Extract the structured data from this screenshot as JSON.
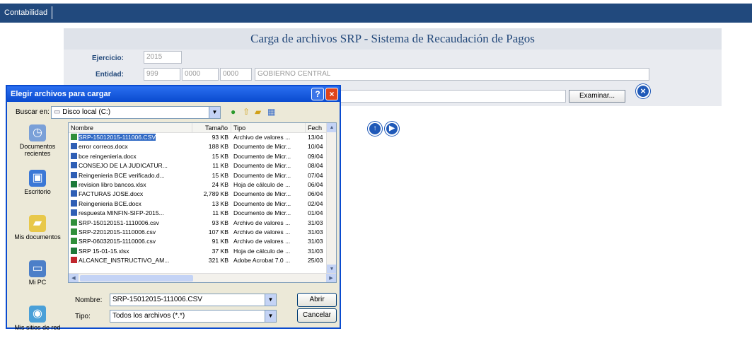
{
  "app": {
    "tab_label": "Contabilidad"
  },
  "form": {
    "title": "Carga de archivos SRP - Sistema de Recaudación de Pagos",
    "ejercicio_label": "Ejercicio:",
    "ejercicio_value": "2015",
    "entidad_label": "Entidad:",
    "entidad_values": [
      "999",
      "0000",
      "0000"
    ],
    "entidad_name": "GOBIERNO CENTRAL",
    "browse_label": "Examinar..."
  },
  "dialog": {
    "title": "Elegir archivos para cargar",
    "lookin_label": "Buscar en:",
    "lookin_value": "Disco local (C:)",
    "places": [
      {
        "label": "Documentos recientes",
        "icon": "recent-documents-icon"
      },
      {
        "label": "Escritorio",
        "icon": "desktop-icon"
      },
      {
        "label": "Mis documentos",
        "icon": "my-documents-icon"
      },
      {
        "label": "Mi PC",
        "icon": "my-computer-icon"
      },
      {
        "label": "Mis sitios de red",
        "icon": "network-places-icon"
      }
    ],
    "columns": [
      "Nombre",
      "Tamaño",
      "Tipo",
      "Fech"
    ],
    "files": [
      {
        "name": "SRP-15012015-111006.CSV",
        "size": "93 KB",
        "type": "Archivo de valores ...",
        "date": "13/04",
        "kind": "csv"
      },
      {
        "name": "error correos.docx",
        "size": "188 KB",
        "type": "Documento de Micr...",
        "date": "10/04",
        "kind": "doc"
      },
      {
        "name": "bce reingenieria.docx",
        "size": "15 KB",
        "type": "Documento de Micr...",
        "date": "09/04",
        "kind": "doc"
      },
      {
        "name": "CONSEJO DE LA JUDICATUR...",
        "size": "11 KB",
        "type": "Documento de Micr...",
        "date": "08/04",
        "kind": "doc"
      },
      {
        "name": "Reingenieria BCE verificado.d...",
        "size": "15 KB",
        "type": "Documento de Micr...",
        "date": "07/04",
        "kind": "doc"
      },
      {
        "name": "revision libro bancos.xlsx",
        "size": "24 KB",
        "type": "Hoja de cálculo de ...",
        "date": "06/04",
        "kind": "xls"
      },
      {
        "name": "FACTURAS JOSE.docx",
        "size": "2,789 KB",
        "type": "Documento de Micr...",
        "date": "06/04",
        "kind": "doc"
      },
      {
        "name": "Reingenieria BCE.docx",
        "size": "13 KB",
        "type": "Documento de Micr...",
        "date": "02/04",
        "kind": "doc"
      },
      {
        "name": "respuesta MINFIN-SIFP-2015...",
        "size": "11 KB",
        "type": "Documento de Micr...",
        "date": "01/04",
        "kind": "doc"
      },
      {
        "name": "SRP-150120151-1110006.csv",
        "size": "93 KB",
        "type": "Archivo de valores ...",
        "date": "31/03",
        "kind": "csv"
      },
      {
        "name": "SRP-22012015-1110006.csv",
        "size": "107 KB",
        "type": "Archivo de valores ...",
        "date": "31/03",
        "kind": "csv"
      },
      {
        "name": "SRP-06032015-1110006.csv",
        "size": "91 KB",
        "type": "Archivo de valores ...",
        "date": "31/03",
        "kind": "csv"
      },
      {
        "name": "SRP 15-01-15.xlsx",
        "size": "37 KB",
        "type": "Hoja de cálculo de ...",
        "date": "31/03",
        "kind": "xls"
      },
      {
        "name": "ALCANCE_INSTRUCTIVO_AM...",
        "size": "321 KB",
        "type": "Adobe Acrobat 7.0 ...",
        "date": "25/03",
        "kind": "pdf"
      }
    ],
    "filename_label": "Nombre:",
    "filename_value": "SRP-15012015-111006.CSV",
    "filetype_label": "Tipo:",
    "filetype_value": "Todos los archivos (*.*)",
    "open_label": "Abrir",
    "cancel_label": "Cancelar"
  },
  "colors": {
    "topbar": "#21497d",
    "dialog_title": "#0a4bcf",
    "selection": "#316ac5"
  }
}
